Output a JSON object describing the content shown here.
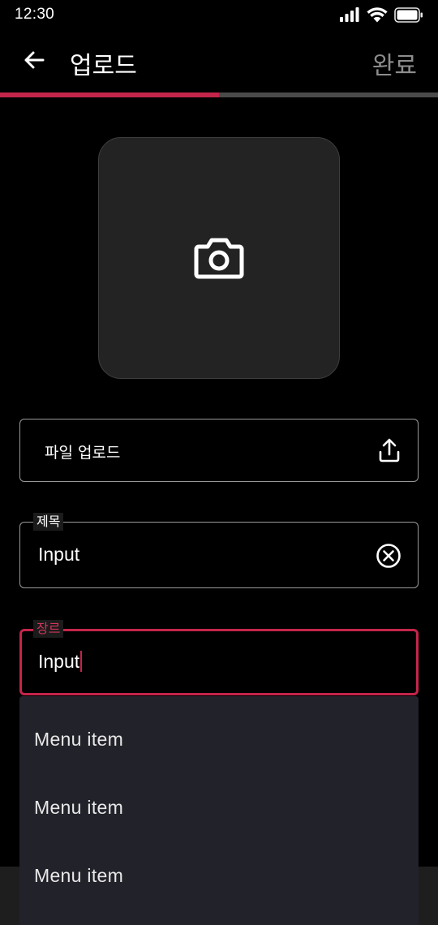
{
  "status_bar": {
    "time": "12:30"
  },
  "app_bar": {
    "title": "업로드",
    "done_label": "완료"
  },
  "progress": {
    "fraction": 0.5,
    "fill_color": "#c4254a",
    "track_color": "#4a4a4a"
  },
  "photo_picker": {
    "icon": "camera-icon"
  },
  "file_upload": {
    "label": "파일 업로드",
    "icon": "upload-icon"
  },
  "title_field": {
    "label": "제목",
    "value": "Input",
    "icon": "clear-circle-icon"
  },
  "genre_field": {
    "label": "장르",
    "value": "Input",
    "accent_color": "#c4254a"
  },
  "genre_menu": {
    "items": [
      {
        "label": "Menu item"
      },
      {
        "label": "Menu item"
      },
      {
        "label": "Menu item"
      }
    ]
  }
}
